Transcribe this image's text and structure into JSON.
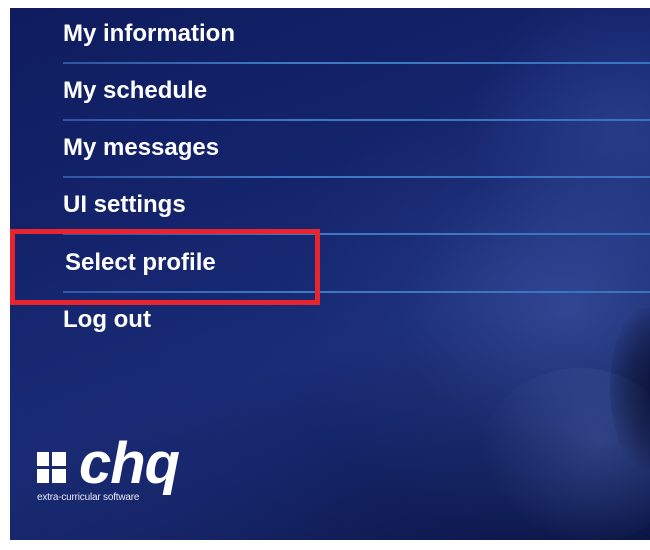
{
  "menu": {
    "items": [
      {
        "label": "My information"
      },
      {
        "label": "My schedule"
      },
      {
        "label": "My messages"
      },
      {
        "label": "UI settings"
      },
      {
        "label": "Select profile"
      },
      {
        "label": "Log out"
      }
    ],
    "highlighted_item": "Select profile"
  },
  "logo": {
    "wordmark": "chq",
    "tagline": "extra-curricular software"
  },
  "colors": {
    "background": "#14246c",
    "divider": "#3f79c4",
    "highlight_border": "#e8242f",
    "text": "#ffffff"
  }
}
